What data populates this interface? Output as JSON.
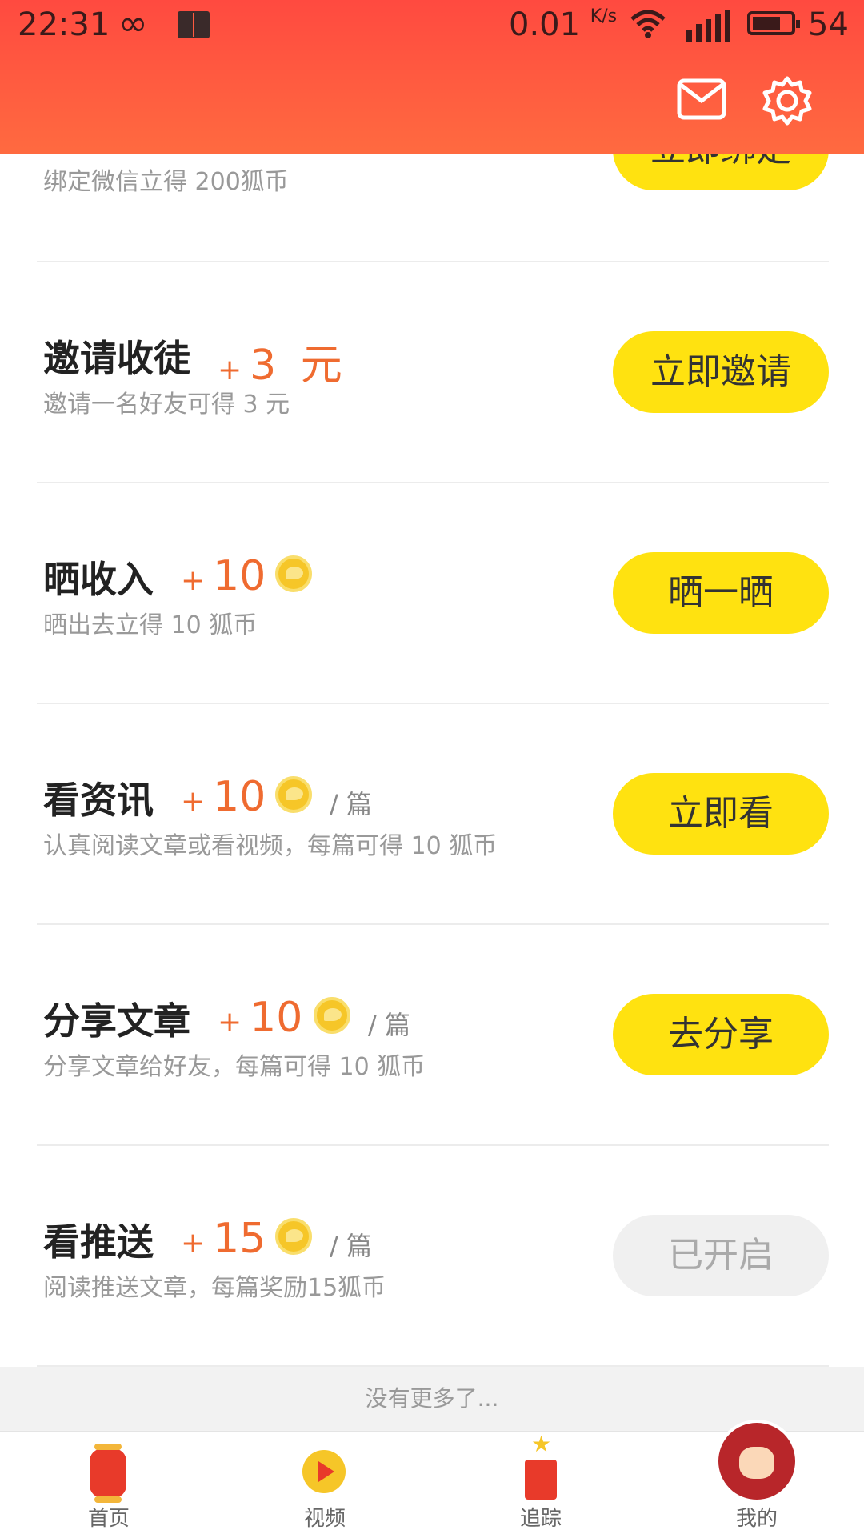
{
  "status": {
    "time": "22:31",
    "speed": "0.01",
    "speed_unit": "K/s",
    "battery": "54"
  },
  "header": {
    "mail_icon": "mail-icon",
    "settings_icon": "gear-icon"
  },
  "rows": [
    {
      "title": "",
      "desc": "绑定微信立得 200狐币",
      "button": "立即绑定"
    },
    {
      "title": "邀请收徒",
      "plus": "+",
      "reward": "3",
      "reward_suffix": "元",
      "desc": "邀请一名好友可得 3 元",
      "button": "立即邀请"
    },
    {
      "title": "晒收入",
      "plus": "+",
      "reward": "10",
      "desc": "晒出去立得 10 狐币",
      "button": "晒一晒"
    },
    {
      "title": "看资讯",
      "plus": "+",
      "reward": "10",
      "unit": "/ 篇",
      "desc": "认真阅读文章或看视频，每篇可得 10 狐币",
      "button": "立即看"
    },
    {
      "title": "分享文章",
      "plus": "+",
      "reward": "10",
      "unit": "/ 篇",
      "desc": "分享文章给好友，每篇可得 10 狐币",
      "button": "去分享"
    },
    {
      "title": "看推送",
      "plus": "+",
      "reward": "15",
      "unit": "/ 篇",
      "desc": "阅读推送文章，每篇奖励15狐币",
      "button": "已开启"
    }
  ],
  "end_text": "没有更多了...",
  "tabs": [
    {
      "label": "首页",
      "icon": "lantern-icon"
    },
    {
      "label": "视频",
      "icon": "video-play-icon"
    },
    {
      "label": "追踪",
      "icon": "firecracker-icon"
    },
    {
      "label": "我的",
      "icon": "avatar-icon"
    }
  ],
  "colors": {
    "header": "#ff4a40",
    "button": "#ffe210",
    "reward": "#ef6b30",
    "disabled": "#f0f0f0"
  }
}
